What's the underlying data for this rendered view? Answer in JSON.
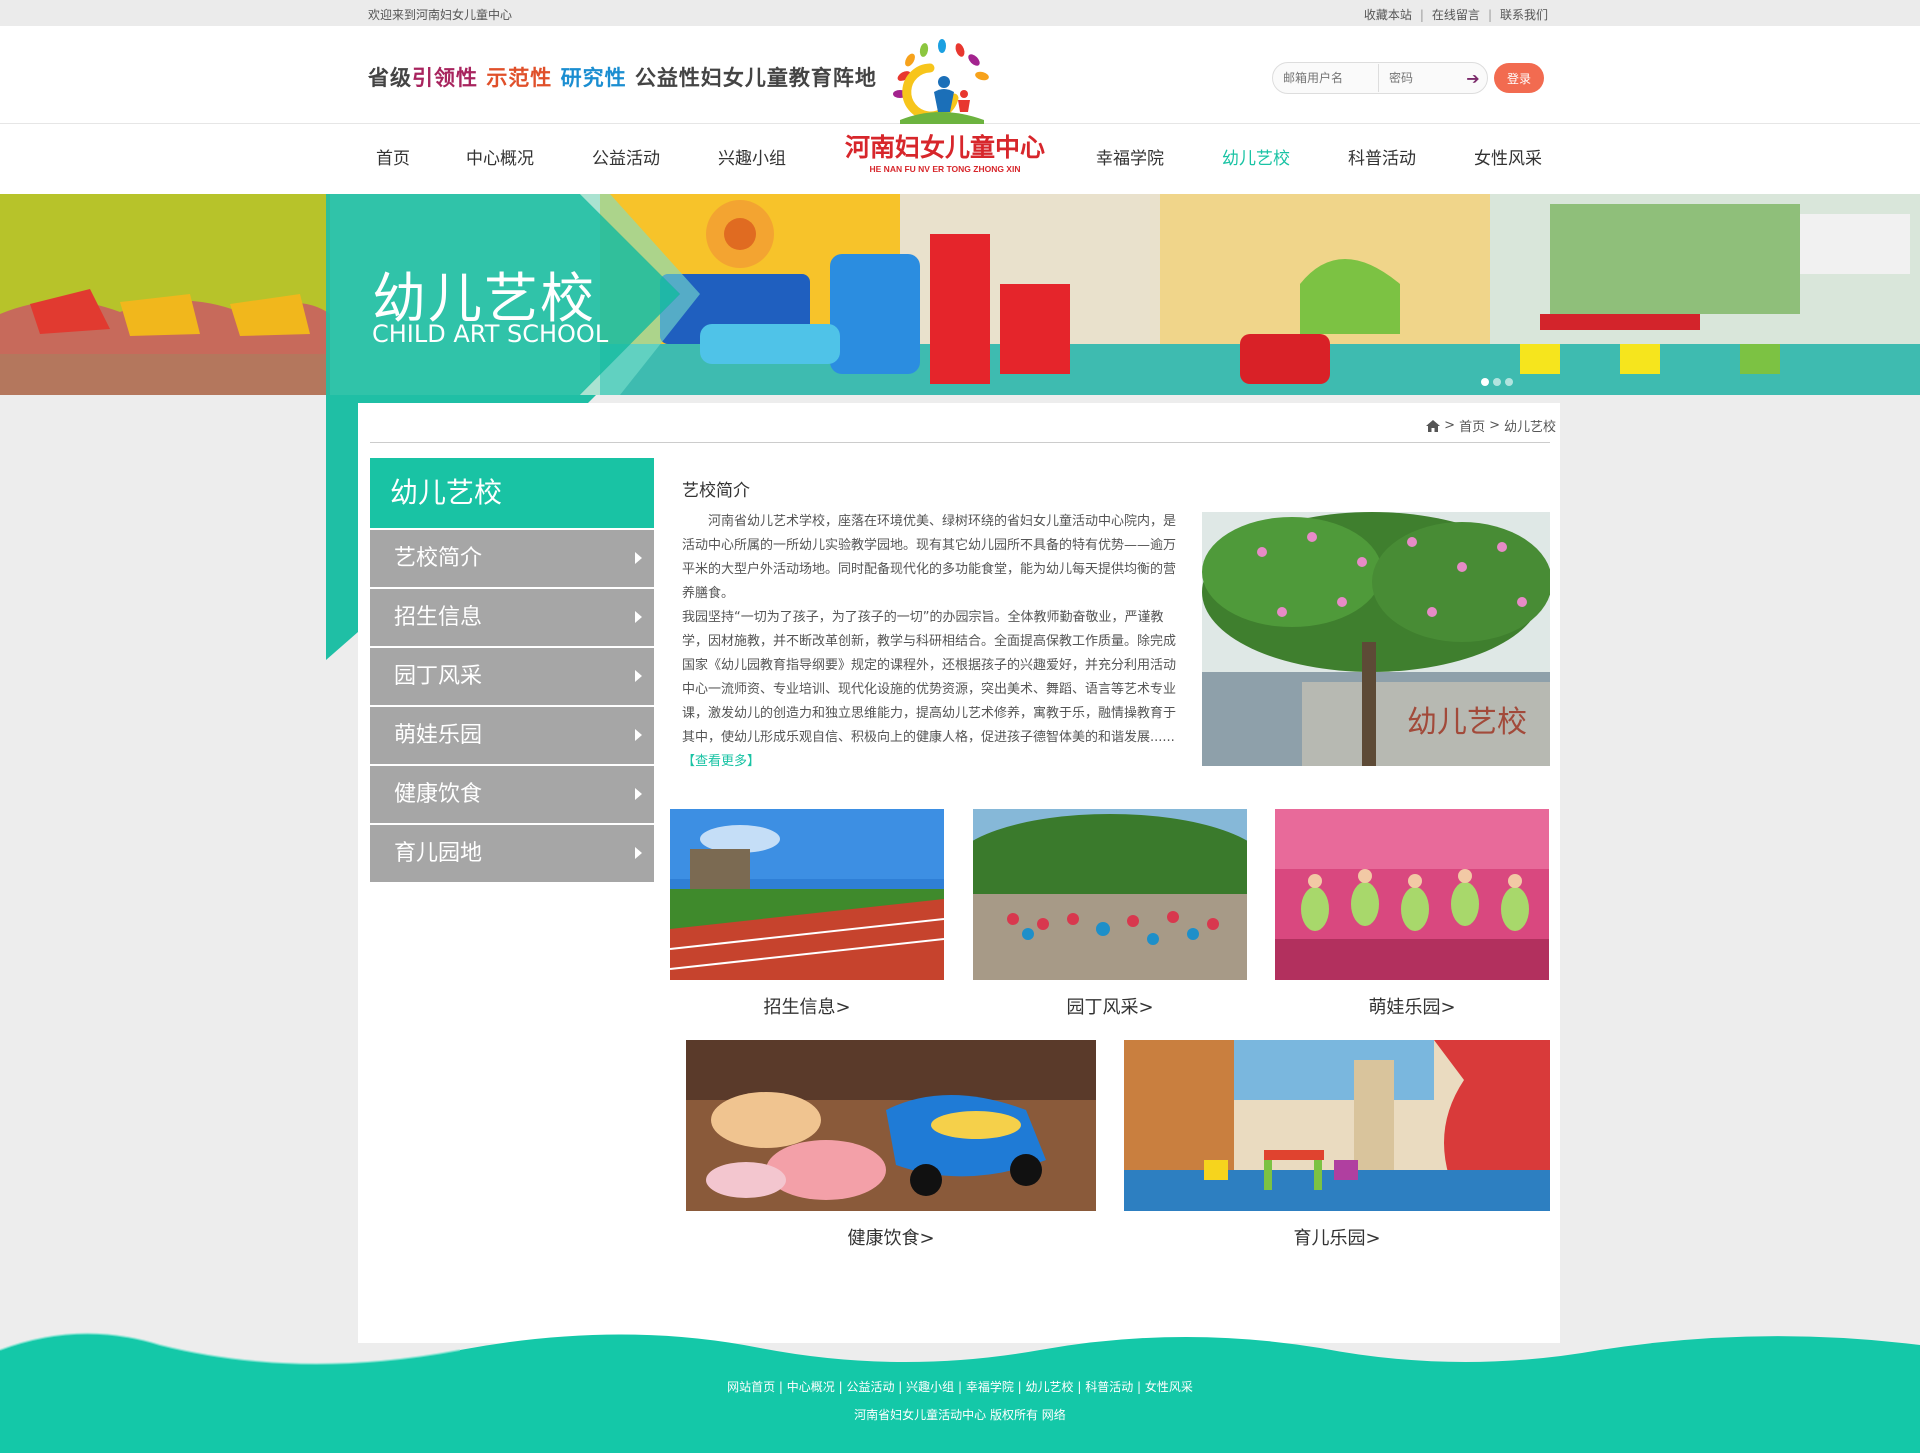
{
  "topbar": {
    "welcome": "欢迎来到河南妇女儿童中心",
    "links": [
      "收藏本站",
      "在线留言",
      "联系我们"
    ]
  },
  "header": {
    "slogan": [
      "省级",
      "引领性",
      "示范性",
      "研究性",
      "公益性妇女儿童教育阵地"
    ],
    "logo_title": "河南妇女儿童中心",
    "logo_sub": "HE NAN FU NV ER TONG ZHONG XIN",
    "login": {
      "username_placeholder": "邮箱用户名",
      "password_placeholder": "密码",
      "button": "登录"
    }
  },
  "nav": {
    "left": [
      "首页",
      "中心概况",
      "公益活动",
      "兴趣小组"
    ],
    "right": [
      "幸福学院",
      "幼儿艺校",
      "科普活动",
      "女性风采"
    ],
    "active": "幼儿艺校"
  },
  "banner": {
    "title_cn": "幼儿艺校",
    "title_en": "CHILD ART SCHOOL"
  },
  "breadcrumb": {
    "home": "首页",
    "current": "幼儿艺校"
  },
  "sidebar": {
    "title": "幼儿艺校",
    "items": [
      "艺校简介",
      "招生信息",
      "园丁风采",
      "萌娃乐园",
      "健康饮食",
      "育儿园地"
    ]
  },
  "intro": {
    "title": "艺校简介",
    "p1": "河南省幼儿艺术学校，座落在环境优美、绿树环绕的省妇女儿童活动中心院内，是活动中心所属的一所幼儿实验教学园地。现有其它幼儿园所不具备的特有优势——逾万平米的大型户外活动场地。同时配备现代化的多功能食堂，能为幼儿每天提供均衡的营养膳食。",
    "p2": "我园坚持“一切为了孩子，为了孩子的一切”的办园宗旨。全体教师勤奋敬业，严谨教学，因材施教，并不断改革创新，教学与科研相结合。全面提高保教工作质量。除完成国家《幼儿园教育指导纲要》规定的课程外，还根据孩子的兴趣爱好，并充分利用活动中心一流师资、专业培训、现代化设施的优势资源，突出美术、舞蹈、语言等艺术专业课，激发幼儿的创造力和独立思维能力，提高幼儿艺术修养，寓教于乐，融情操教育于其中，使幼儿形成乐观自信、积极向上的健康人格，促进孩子德智体美的和谐发展......",
    "more": "【查看更多】",
    "sign_text": "幼儿艺校"
  },
  "tiles": [
    {
      "caption": "招生信息"
    },
    {
      "caption": "园丁风采"
    },
    {
      "caption": "萌娃乐园"
    },
    {
      "caption": "健康饮食"
    },
    {
      "caption": "育儿乐园"
    }
  ],
  "footer": {
    "links": [
      "网站首页",
      "中心概况",
      "公益活动",
      "兴趣小组",
      "幸福学院",
      "幼儿艺校",
      "科普活动",
      "女性风采"
    ],
    "copyright": "河南省妇女儿童活动中心  版权所有    网络"
  },
  "colors": {
    "accent": "#19c3a4",
    "login_button": "#f26b50",
    "sidebar_item": "#a6a6a6",
    "footer": "#14c8a8"
  }
}
